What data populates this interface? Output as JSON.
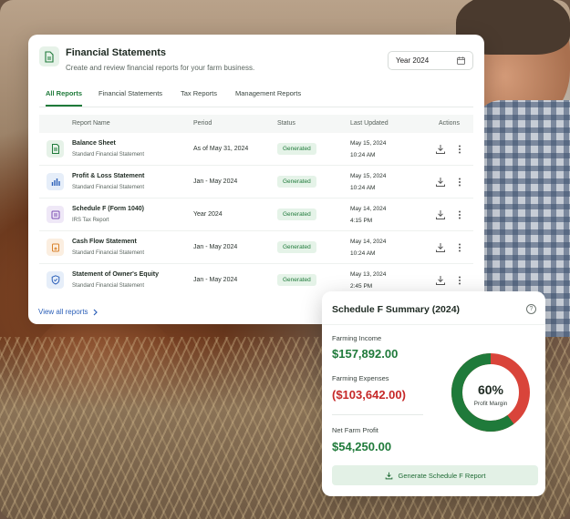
{
  "colors": {
    "brand_green": "#1f7a3a",
    "status_bg": "#e5f3e8",
    "expense_red": "#c62828",
    "income_green": "#1f7a3a",
    "donut_red": "#d9443a",
    "donut_green": "#1f7a3a",
    "link_blue": "#2b5fb8"
  },
  "header": {
    "icon": "document-icon",
    "title": "Financial Statements",
    "subtitle": "Create and review financial reports for your farm business.",
    "year_select": {
      "value": "Year 2024",
      "icon": "calendar-icon"
    }
  },
  "tabs": [
    {
      "label": "All Reports",
      "active": true
    },
    {
      "label": "Financial Statements",
      "active": false
    },
    {
      "label": "Tax Reports",
      "active": false
    },
    {
      "label": "Management Reports",
      "active": false
    }
  ],
  "table": {
    "columns": [
      "Report Name",
      "Period",
      "Status",
      "Last Updated",
      "Actions"
    ],
    "rows": [
      {
        "icon": "sheet-icon",
        "name": "Balance Sheet",
        "type": "Standard Financial Statement",
        "period": "As of May 31, 2024",
        "status": "Generated",
        "date": "May 15, 2024",
        "time": "10:24 AM"
      },
      {
        "icon": "bar-chart-icon",
        "name": "Profit & Loss Statement",
        "type": "Standard Financial Statement",
        "period": "Jan - May 2024",
        "status": "Generated",
        "date": "May 15, 2024",
        "time": "10:24 AM"
      },
      {
        "icon": "form-icon",
        "name": "Schedule F (Form 1040)",
        "type": "IRS Tax Report",
        "period": "Year 2024",
        "status": "Generated",
        "date": "May 14, 2024",
        "time": "4:15 PM"
      },
      {
        "icon": "cash-flow-icon",
        "name": "Cash Flow Statement",
        "type": "Standard Financial Statement",
        "period": "Jan - May 2024",
        "status": "Generated",
        "date": "May 14, 2024",
        "time": "10:24 AM"
      },
      {
        "icon": "shield-check-icon",
        "name": "Statement of Owner's Equity",
        "type": "Standard Financial Statement",
        "period": "Jan - May 2024",
        "status": "Generated",
        "date": "May 13, 2024",
        "time": "2:45 PM"
      }
    ]
  },
  "view_all": {
    "label": "View all reports",
    "icon": "chevron-right-icon"
  },
  "schedule_f": {
    "title": "Schedule F Summary (2024)",
    "help_icon": "question-circle-icon",
    "income_label": "Farming Income",
    "income_value": "$157,892.00",
    "expenses_label": "Farming Expenses",
    "expenses_value": "($103,642.00)",
    "profit_label": "Net Farm Profit",
    "profit_value": "$54,250.00",
    "margin_value": "60%",
    "margin_label": "Profit Margin",
    "margin_fraction": 0.6,
    "button_label": "Generate Schedule F Report",
    "button_icon": "download-icon"
  }
}
